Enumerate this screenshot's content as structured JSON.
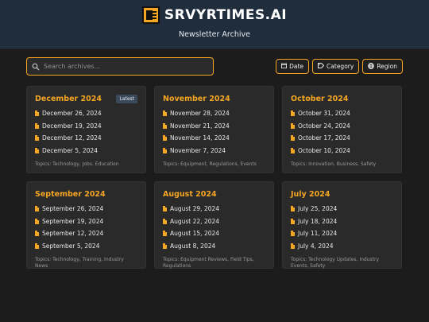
{
  "header": {
    "brand": "SRVYRTIMES.AI",
    "subtitle": "Newsletter Archive"
  },
  "search": {
    "placeholder": "Search archives..."
  },
  "filters": [
    {
      "label": "Date",
      "icon": "calendar-icon"
    },
    {
      "label": "Category",
      "icon": "tag-icon"
    },
    {
      "label": "Region",
      "icon": "globe-icon"
    }
  ],
  "accent": "#f5a623",
  "cards": [
    {
      "title": "December 2024",
      "badge": "Latest",
      "items": [
        "December 26, 2024",
        "December 19, 2024",
        "December 12, 2024",
        "December 5, 2024"
      ],
      "topics": "Topics: Technology, Jobs, Education"
    },
    {
      "title": "November 2024",
      "badge": "",
      "items": [
        "November 28, 2024",
        "November 21, 2024",
        "November 14, 2024",
        "November 7, 2024"
      ],
      "topics": "Topics: Equipment, Regulations, Events"
    },
    {
      "title": "October 2024",
      "badge": "",
      "items": [
        "October 31, 2024",
        "October 24, 2024",
        "October 17, 2024",
        "October 10, 2024"
      ],
      "topics": "Topics: Innovation, Business, Safety"
    },
    {
      "title": "September 2024",
      "badge": "",
      "items": [
        "September 26, 2024",
        "September 19, 2024",
        "September 12, 2024",
        "September 5, 2024"
      ],
      "topics": "Topics: Technology, Training, Industry News"
    },
    {
      "title": "August 2024",
      "badge": "",
      "items": [
        "August 29, 2024",
        "August 22, 2024",
        "August 15, 2024",
        "August 8, 2024"
      ],
      "topics": "Topics: Equipment Reviews, Field Tips, Regulations"
    },
    {
      "title": "July 2024",
      "badge": "",
      "items": [
        "July 25, 2024",
        "July 18, 2024",
        "July 11, 2024",
        "July 4, 2024"
      ],
      "topics": "Topics: Technology Updates, Industry Events, Safety"
    }
  ]
}
